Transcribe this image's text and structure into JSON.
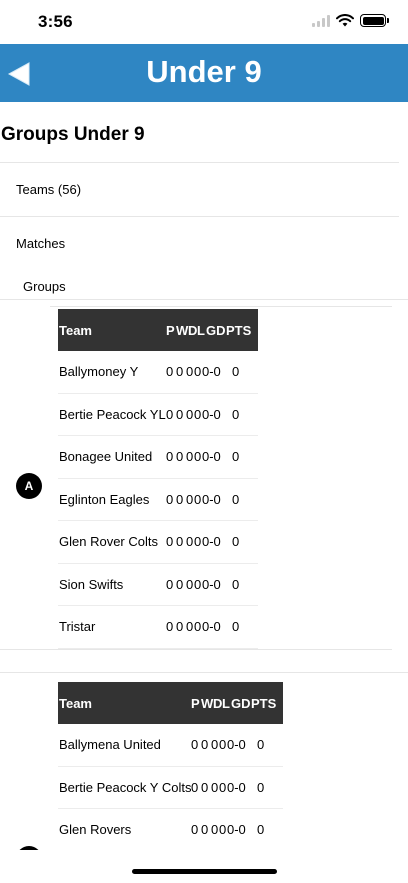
{
  "status": {
    "time": "3:56"
  },
  "nav": {
    "title": "Under 9"
  },
  "page": {
    "heading": "Groups Under 9"
  },
  "menu": {
    "teams": "Teams (56)",
    "matches": "Matches",
    "groups": "Groups"
  },
  "table_headers": {
    "team": "Team",
    "p": "P",
    "w": "W",
    "d": "D",
    "l": "L",
    "gd": "GD",
    "pts": "PTS"
  },
  "groups": [
    {
      "label": "A",
      "rows": [
        {
          "team": "Ballymoney Y",
          "p": "0",
          "w": "0",
          "d": "0",
          "l": "0",
          "gd": "0-0",
          "pts": "0"
        },
        {
          "team": "Bertie Peacock YL",
          "p": "0",
          "w": "0",
          "d": "0",
          "l": "0",
          "gd": "0-0",
          "pts": "0"
        },
        {
          "team": "Bonagee United",
          "p": "0",
          "w": "0",
          "d": "0",
          "l": "0",
          "gd": "0-0",
          "pts": "0"
        },
        {
          "team": "Eglinton Eagles",
          "p": "0",
          "w": "0",
          "d": "0",
          "l": "0",
          "gd": "0-0",
          "pts": "0"
        },
        {
          "team": "Glen Rover Colts",
          "p": "0",
          "w": "0",
          "d": "0",
          "l": "0",
          "gd": "0-0",
          "pts": "0"
        },
        {
          "team": "Sion Swifts",
          "p": "0",
          "w": "0",
          "d": "0",
          "l": "0",
          "gd": "0-0",
          "pts": "0"
        },
        {
          "team": "Tristar",
          "p": "0",
          "w": "0",
          "d": "0",
          "l": "0",
          "gd": "0-0",
          "pts": "0"
        }
      ]
    },
    {
      "label": "",
      "rows": [
        {
          "team": "Ballymena United",
          "p": "0",
          "w": "0",
          "d": "0",
          "l": "0",
          "gd": "0-0",
          "pts": "0"
        },
        {
          "team": "Bertie Peacock Y Colts",
          "p": "0",
          "w": "0",
          "d": "0",
          "l": "0",
          "gd": "0-0",
          "pts": "0"
        },
        {
          "team": "Glen Rovers",
          "p": "0",
          "w": "0",
          "d": "0",
          "l": "0",
          "gd": "0-0",
          "pts": "0"
        }
      ]
    }
  ]
}
